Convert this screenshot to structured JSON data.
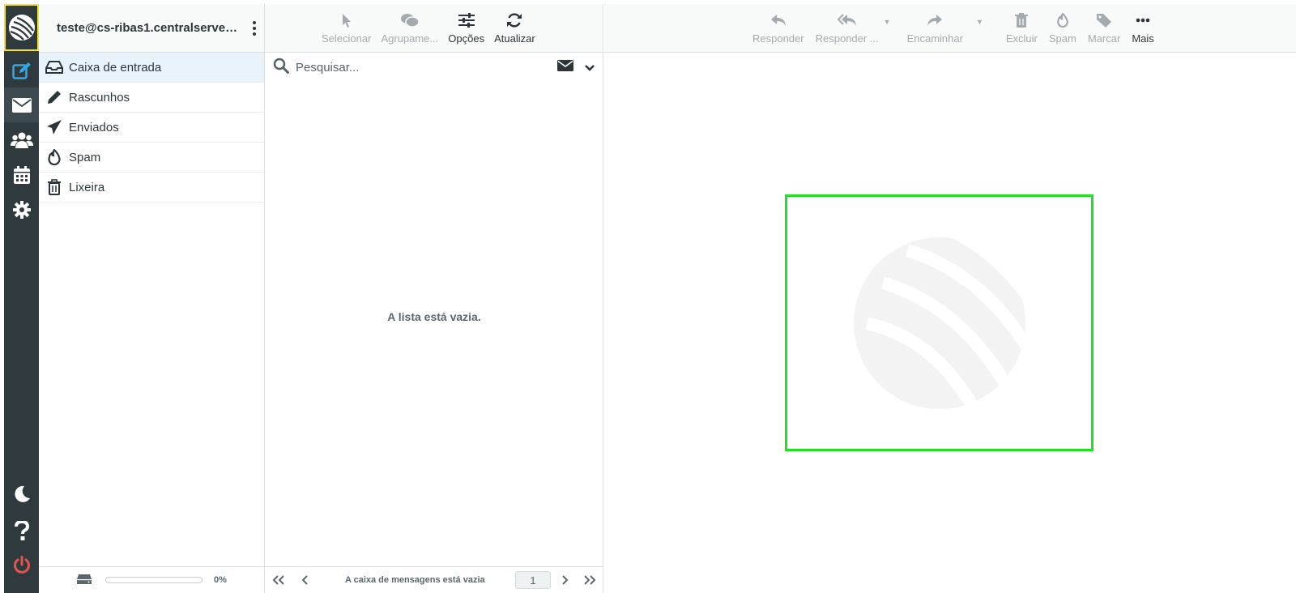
{
  "account": {
    "email": "teste@cs-ribas1.centralserver.co..."
  },
  "rail": {
    "items": [
      {
        "name": "compose",
        "icon": "compose-icon"
      },
      {
        "name": "mail",
        "icon": "envelope-icon"
      },
      {
        "name": "contacts",
        "icon": "users-icon"
      },
      {
        "name": "calendar",
        "icon": "calendar-icon"
      },
      {
        "name": "settings",
        "icon": "gear-icon"
      }
    ],
    "bottom": [
      {
        "name": "dark-mode",
        "icon": "moon-icon"
      },
      {
        "name": "help",
        "icon": "question-icon"
      },
      {
        "name": "logout",
        "icon": "power-icon"
      }
    ],
    "accent": "#33a8e4",
    "logout_color": "#e5544b"
  },
  "folders": [
    {
      "label": "Caixa de entrada",
      "icon": "inbox-icon",
      "selected": true
    },
    {
      "label": "Rascunhos",
      "icon": "pencil-icon",
      "selected": false
    },
    {
      "label": "Enviados",
      "icon": "paper-plane-icon",
      "selected": false
    },
    {
      "label": "Spam",
      "icon": "fire-icon",
      "selected": false
    },
    {
      "label": "Lixeira",
      "icon": "trash-icon",
      "selected": false
    }
  ],
  "quota": {
    "percent_label": "0%",
    "percent": 0
  },
  "list_toolbar": {
    "select": "Selecionar",
    "group": "Agrupame...",
    "options": "Opções",
    "refresh": "Atualizar"
  },
  "search": {
    "placeholder": "Pesquisar..."
  },
  "list": {
    "empty_message": "A lista está vazia."
  },
  "pager": {
    "status": "A caixa de mensagens está vazia",
    "page": "1"
  },
  "preview_toolbar": {
    "reply": "Responder",
    "reply_all": "Responder ...",
    "forward": "Encaminhar",
    "delete": "Excluir",
    "spam": "Spam",
    "mark": "Marcar",
    "more": "Mais"
  }
}
